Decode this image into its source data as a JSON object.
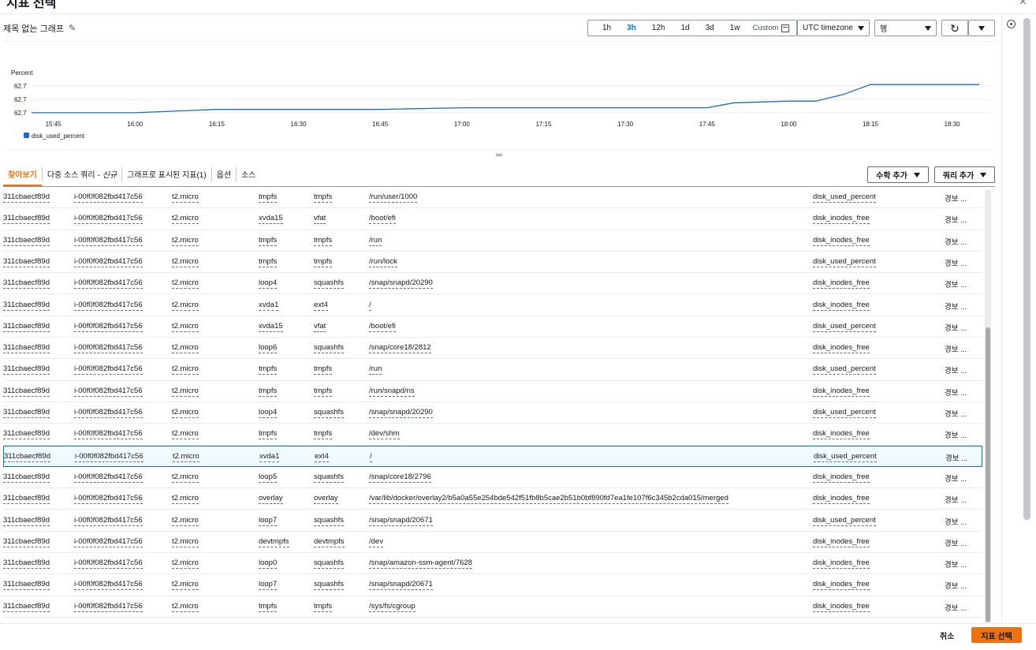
{
  "modal": {
    "title": "지표 선택",
    "close": "×"
  },
  "graph": {
    "title": "제목 없는 그래프",
    "ranges": [
      "1h",
      "3h",
      "12h",
      "1d",
      "3d",
      "1w"
    ],
    "active_range": "3h",
    "custom_label": "Custom",
    "timezone": "UTC timezone",
    "view_type": "행",
    "refresh": "↻"
  },
  "chart_data": {
    "type": "line",
    "ylabel": "Percent",
    "y_tick_labels": [
      "62.7",
      "62.7",
      "62.7"
    ],
    "x_tick_labels": [
      "15:45",
      "16:00",
      "16:15",
      "16:30",
      "16:45",
      "17:00",
      "17:15",
      "17:30",
      "17:45",
      "18:00",
      "18:15",
      "18:30"
    ],
    "series": [
      {
        "name": "disk_used_percent",
        "color": "#1f69c1",
        "x": [
          "15:41",
          "15:45",
          "16:00",
          "16:15",
          "16:30",
          "16:45",
          "17:00",
          "17:15",
          "17:30",
          "17:45",
          "17:50",
          "18:00",
          "18:05",
          "18:10",
          "18:15",
          "18:30",
          "18:35"
        ],
        "values": [
          62.7,
          62.7,
          62.7,
          62.702,
          62.702,
          62.702,
          62.703,
          62.703,
          62.703,
          62.703,
          62.706,
          62.707,
          62.707,
          62.711,
          62.717,
          62.717,
          62.717
        ]
      }
    ],
    "ylim": [
      62.699,
      62.719
    ],
    "xlim": [
      "15:41",
      "18:37"
    ],
    "grid": true,
    "legend": "bottom-left"
  },
  "tabs": [
    {
      "label": "찾아보기",
      "active": true
    },
    {
      "label": "다중 소스 쿼리 -",
      "tag": "신규"
    },
    {
      "label": "그래프로 표시된 지표(1)"
    },
    {
      "label": "옵션"
    },
    {
      "label": "소스"
    }
  ],
  "actions": {
    "math": "수학 추가",
    "query": "쿼리 추가"
  },
  "rows": [
    [
      "311cbaecf89d",
      "i-00f0f082fbd417c56",
      "t2.micro",
      "tmpfs",
      "tmpfs",
      "/run/user/1000",
      "disk_used_percent",
      "경보 ..."
    ],
    [
      "311cbaecf89d",
      "i-00f0f082fbd417c56",
      "t2.micro",
      "xvda15",
      "vfat",
      "/boot/efi",
      "disk_inodes_free",
      "경보 ..."
    ],
    [
      "311cbaecf89d",
      "i-00f0f082fbd417c56",
      "t2.micro",
      "tmpfs",
      "tmpfs",
      "/run",
      "disk_inodes_free",
      "경보 ..."
    ],
    [
      "311cbaecf89d",
      "i-00f0f082fbd417c56",
      "t2.micro",
      "tmpfs",
      "tmpfs",
      "/run/lock",
      "disk_used_percent",
      "경보 ..."
    ],
    [
      "311cbaecf89d",
      "i-00f0f082fbd417c56",
      "t2.micro",
      "loop4",
      "squashfs",
      "/snap/snapd/20290",
      "disk_inodes_free",
      "경보 ..."
    ],
    [
      "311cbaecf89d",
      "i-00f0f082fbd417c56",
      "t2.micro",
      "xvda1",
      "ext4",
      "/",
      "disk_inodes_free",
      "경보 ..."
    ],
    [
      "311cbaecf89d",
      "i-00f0f082fbd417c56",
      "t2.micro",
      "xvda15",
      "vfat",
      "/boot/efi",
      "disk_used_percent",
      "경보 ..."
    ],
    [
      "311cbaecf89d",
      "i-00f0f082fbd417c56",
      "t2.micro",
      "loop6",
      "squashfs",
      "/snap/core18/2812",
      "disk_inodes_free",
      "경보 ..."
    ],
    [
      "311cbaecf89d",
      "i-00f0f082fbd417c56",
      "t2.micro",
      "tmpfs",
      "tmpfs",
      "/run",
      "disk_used_percent",
      "경보 ..."
    ],
    [
      "311cbaecf89d",
      "i-00f0f082fbd417c56",
      "t2.micro",
      "tmpfs",
      "tmpfs",
      "/run/snapd/ns",
      "disk_inodes_free",
      "경보 ..."
    ],
    [
      "311cbaecf89d",
      "i-00f0f082fbd417c56",
      "t2.micro",
      "loop4",
      "squashfs",
      "/snap/snapd/20290",
      "disk_used_percent",
      "경보 ..."
    ],
    [
      "311cbaecf89d",
      "i-00f0f082fbd417c56",
      "t2.micro",
      "tmpfs",
      "tmpfs",
      "/dev/shm",
      "disk_inodes_free",
      "경보 ..."
    ],
    [
      "311cbaecf89d",
      "i-00f0f082fbd417c56",
      "t2.micro",
      "xvda1",
      "ext4",
      "/",
      "disk_used_percent",
      "경보 ..."
    ],
    [
      "311cbaecf89d",
      "i-00f0f082fbd417c56",
      "t2.micro",
      "loop5",
      "squashfs",
      "/snap/core18/2796",
      "disk_inodes_free",
      "경보 ..."
    ],
    [
      "311cbaecf89d",
      "i-00f0f082fbd417c56",
      "t2.micro",
      "overlay",
      "overlay",
      "/var/lib/docker/overlay2/b5a0a55e254bde542f51fb8b5cae2b51b0bf890fd7ea1fe107f6c345b2cda015/merged",
      "disk_inodes_free",
      "경보 ..."
    ],
    [
      "311cbaecf89d",
      "i-00f0f082fbd417c56",
      "t2.micro",
      "loop7",
      "squashfs",
      "/snap/snapd/20671",
      "disk_used_percent",
      "경보 ..."
    ],
    [
      "311cbaecf89d",
      "i-00f0f082fbd417c56",
      "t2.micro",
      "devtmpfs",
      "devtmpfs",
      "/dev",
      "disk_inodes_free",
      "경보 ..."
    ],
    [
      "311cbaecf89d",
      "i-00f0f082fbd417c56",
      "t2.micro",
      "loop0",
      "squashfs",
      "/snap/amazon-ssm-agent/7628",
      "disk_inodes_free",
      "경보 ..."
    ],
    [
      "311cbaecf89d",
      "i-00f0f082fbd417c56",
      "t2.micro",
      "loop7",
      "squashfs",
      "/snap/snapd/20671",
      "disk_inodes_free",
      "경보 ..."
    ],
    [
      "311cbaecf89d",
      "i-00f0f082fbd417c56",
      "t2.micro",
      "tmpfs",
      "tmpfs",
      "/sys/fs/cgroup",
      "disk_inodes_free",
      "경보 ..."
    ]
  ],
  "selected_row": 12,
  "footer": {
    "cancel": "취소",
    "confirm": "지표 선택"
  }
}
